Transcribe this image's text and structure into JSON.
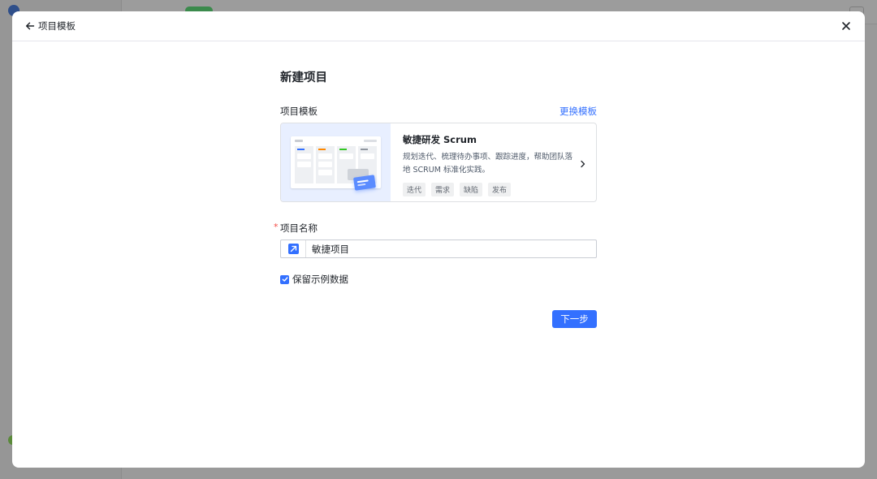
{
  "header": {
    "back_label": "项目模板"
  },
  "form": {
    "title": "新建项目",
    "template_section_label": "项目模板",
    "change_template_label": "更换模板",
    "template": {
      "name": "敏捷研发 Scrum",
      "description": "规划迭代、梳理待办事项、跟踪进度，帮助团队落地 SCRUM 标准化实践。",
      "tags": [
        "迭代",
        "需求",
        "缺陷",
        "发布"
      ]
    },
    "name_field_label": "项目名称",
    "required_mark": "*",
    "name_value": "敏捷项目",
    "keep_sample_data_label": "保留示例数据",
    "keep_sample_data_checked": true,
    "next_button_label": "下一步"
  },
  "colors": {
    "accent": "#3370ff",
    "required": "#f54a45"
  },
  "icons": {
    "back": "arrow-left-icon",
    "close": "close-icon",
    "chevron": "chevron-right-icon",
    "project": "project-icon",
    "checkbox": "check-icon"
  }
}
